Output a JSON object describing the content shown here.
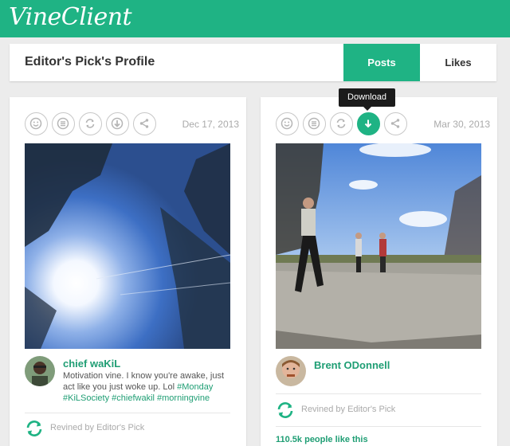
{
  "header": {
    "logo": "VineClient"
  },
  "profile": {
    "title": "Editor's Pick's Profile",
    "tabs": {
      "posts": "Posts",
      "likes": "Likes"
    }
  },
  "tooltip": {
    "text": "Download"
  },
  "posts": [
    {
      "date": "Dec 17, 2013",
      "author": "chief waKiL",
      "desc_parts": {
        "a": "Motivation vine. I know you're awake, just act like you just woke up. Lol ",
        "t1": "#Monday",
        "b": " ",
        "t2": "#KiLSociety",
        "c": " ",
        "t3": "#chiefwakil",
        "d": " ",
        "t4": "#morningvine"
      },
      "revine": "Revined by Editor's Pick"
    },
    {
      "date": "Mar 30, 2013",
      "author": "Brent ODonnell",
      "revine": "Revined by Editor's Pick",
      "likes": "110.5k people like this"
    }
  ],
  "icons": [
    "smile-icon",
    "list-icon",
    "revine-icon",
    "download-icon",
    "share-icon"
  ],
  "colors": {
    "accent": "#1fb384",
    "link": "#1f9e74",
    "background": "#ececec"
  }
}
